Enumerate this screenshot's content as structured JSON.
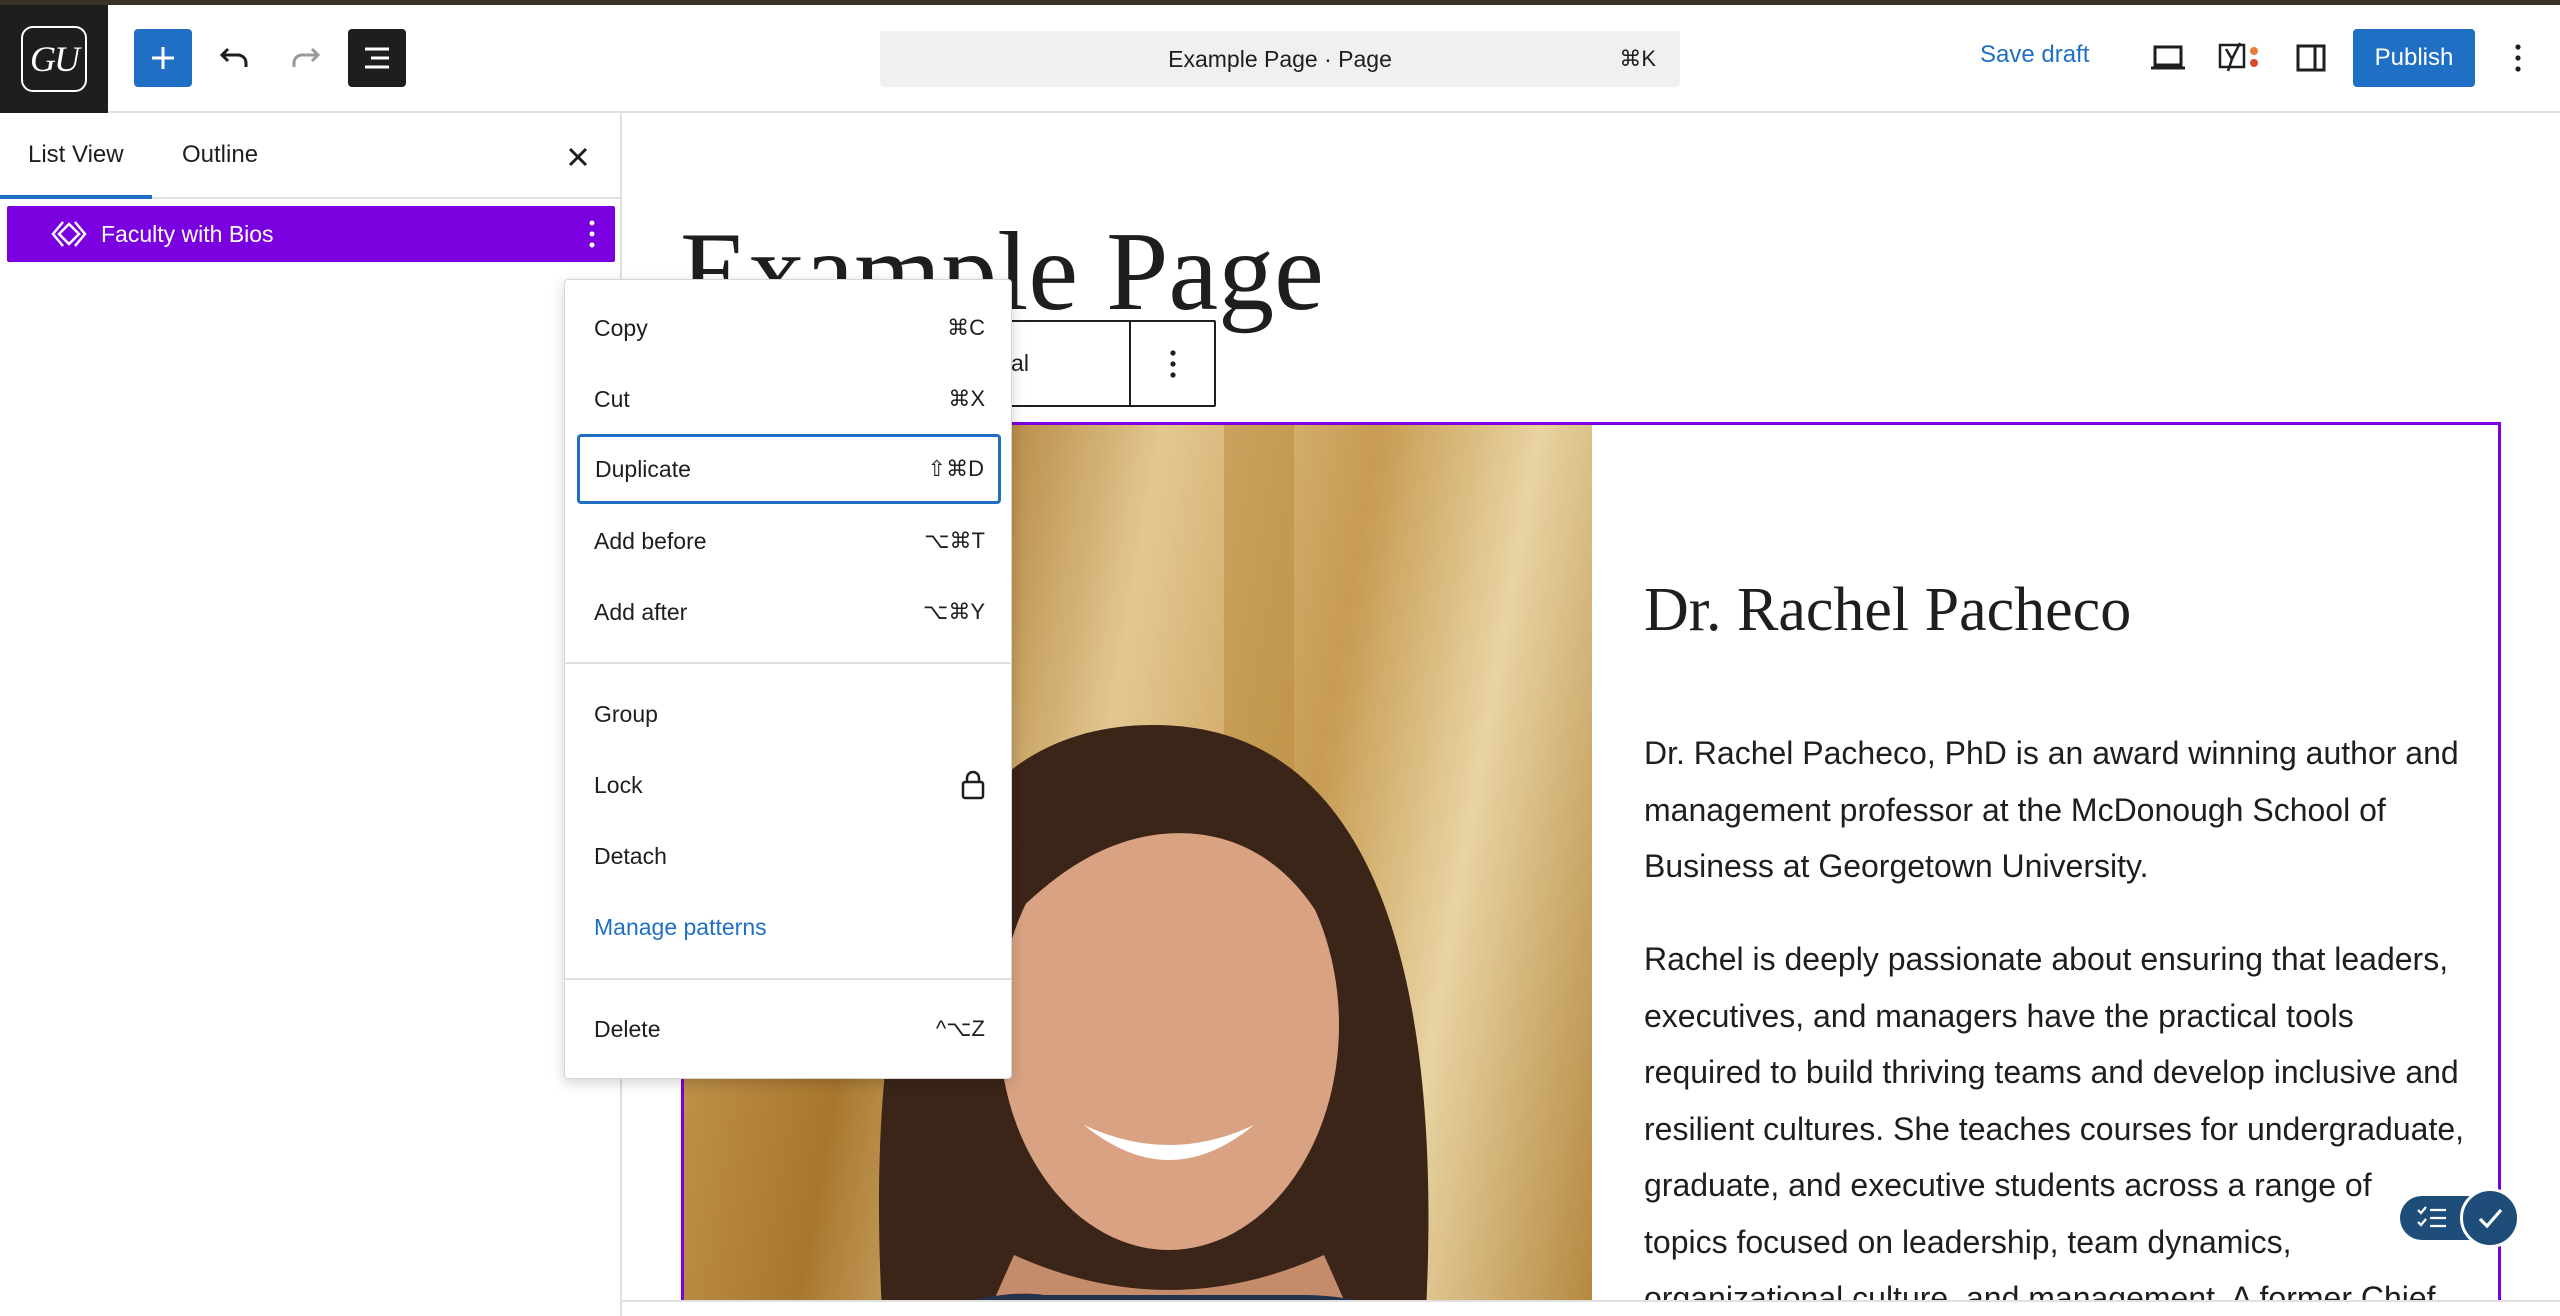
{
  "topbar": {
    "logo_text": "GU",
    "add_label": "+",
    "document_title": "Example Page · Page",
    "command_shortcut": "⌘K",
    "save_draft_label": "Save draft",
    "publish_label": "Publish"
  },
  "sidebar": {
    "tabs": [
      {
        "label": "List View"
      },
      {
        "label": "Outline"
      }
    ],
    "items": [
      {
        "label": "Faculty with Bios"
      }
    ]
  },
  "canvas": {
    "page_title": "Example Page",
    "block_toolbar_label": "t original",
    "bio": {
      "name": "Dr. Rachel Pacheco",
      "paragraph1": "Dr. Rachel Pacheco, PhD is an award winning author and management professor at the McDonough School of Business at Georgetown University.",
      "paragraph2": "Rachel is deeply passionate about ensuring that leaders, executives, and managers have the practical tools required to build thriving teams and develop inclusive and resilient cultures. She teaches courses for undergraduate, graduate, and executive students across a range of topics focused on leadership, team dynamics, organizational culture, and management. A former Chief"
    }
  },
  "menu": {
    "items": [
      {
        "label": "Copy",
        "shortcut": "⌘C"
      },
      {
        "label": "Cut",
        "shortcut": "⌘X"
      },
      {
        "label": "Duplicate",
        "shortcut": "⇧⌘D"
      },
      {
        "label": "Add before",
        "shortcut": "⌥⌘T"
      },
      {
        "label": "Add after",
        "shortcut": "⌥⌘Y"
      },
      {
        "label": "Group",
        "shortcut": ""
      },
      {
        "label": "Lock",
        "shortcut": ""
      },
      {
        "label": "Detach",
        "shortcut": ""
      },
      {
        "label": "Manage patterns",
        "shortcut": ""
      },
      {
        "label": "Delete",
        "shortcut": "^⌥Z"
      }
    ]
  },
  "colors": {
    "accent": "#1f6fc5",
    "pattern_purple": "#7a00df",
    "dark": "#1e1e1e"
  }
}
